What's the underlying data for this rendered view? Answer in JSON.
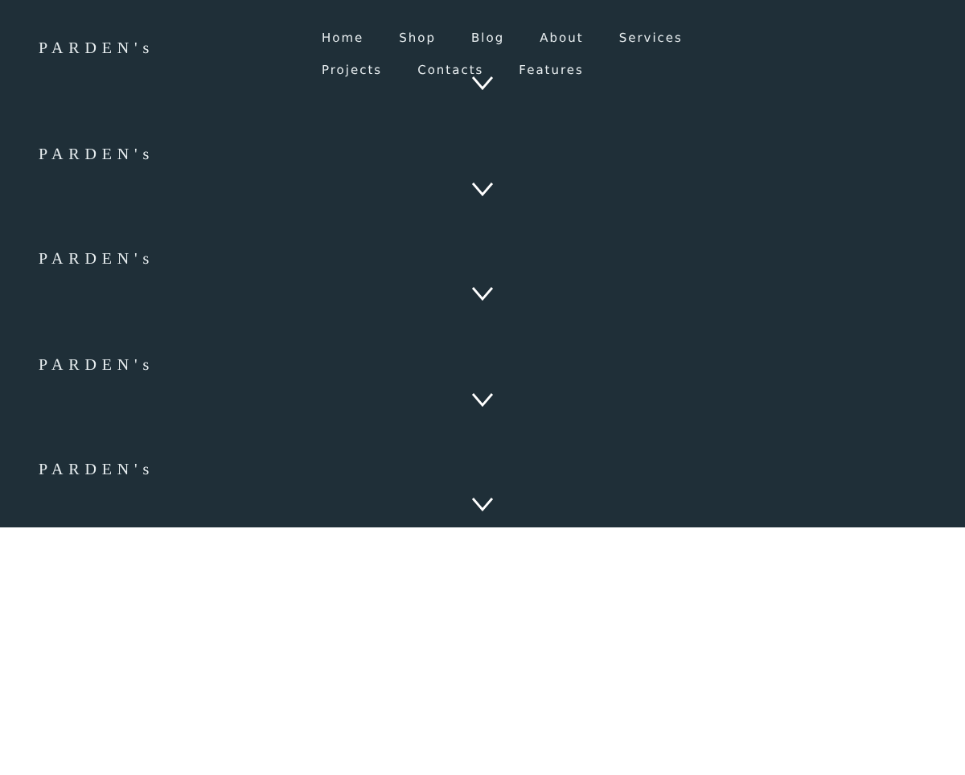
{
  "sections": [
    {
      "logo": "PARDEN's",
      "nav": [
        "Home",
        "Shop",
        "Blog",
        "About",
        "Services",
        "Projects",
        "Contacts",
        "Features"
      ]
    },
    {
      "logo": "PARDEN's"
    },
    {
      "logo": "PARDEN's"
    },
    {
      "logo": "PARDEN's"
    },
    {
      "logo": "PARDEN's"
    }
  ]
}
